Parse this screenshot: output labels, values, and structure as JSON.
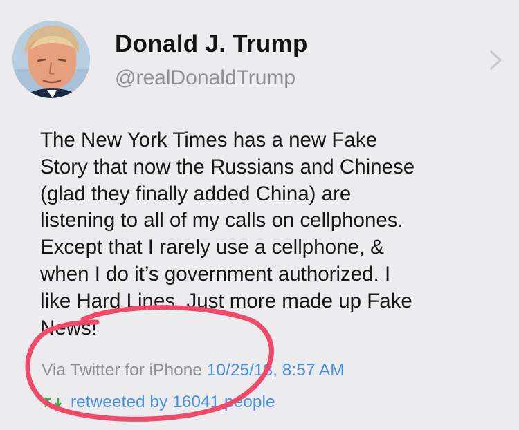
{
  "colors": {
    "background": "#ececee",
    "name_text": "#141414",
    "handle_text": "#8e8e93",
    "link_blue": "#4a90e2",
    "retweet_green": "#2fb24c",
    "annotation_red": "#f04a6a"
  },
  "icons": {
    "avatar": "profile-photo",
    "chevron": "chevron-right-icon",
    "retweet": "retweet-icon"
  },
  "profile": {
    "display_name": "Donald J. Trump",
    "handle": "@realDonaldTrump"
  },
  "tweet": {
    "lines": [
      "The New York Times has a new Fake",
      "Story that now the Russians and Chinese",
      "(glad they finally added China) are",
      "listening to all of my calls on cellphones.",
      "Except that I rarely use a cellphone, &",
      "when I do it’s government authorized. I",
      "like Hard Lines. Just more made up Fake",
      "News!"
    ],
    "via": "Via Twitter for iPhone",
    "timestamp": "10/25/18, 8:57 AM",
    "retweet_text": "retweeted by 16041 people"
  }
}
